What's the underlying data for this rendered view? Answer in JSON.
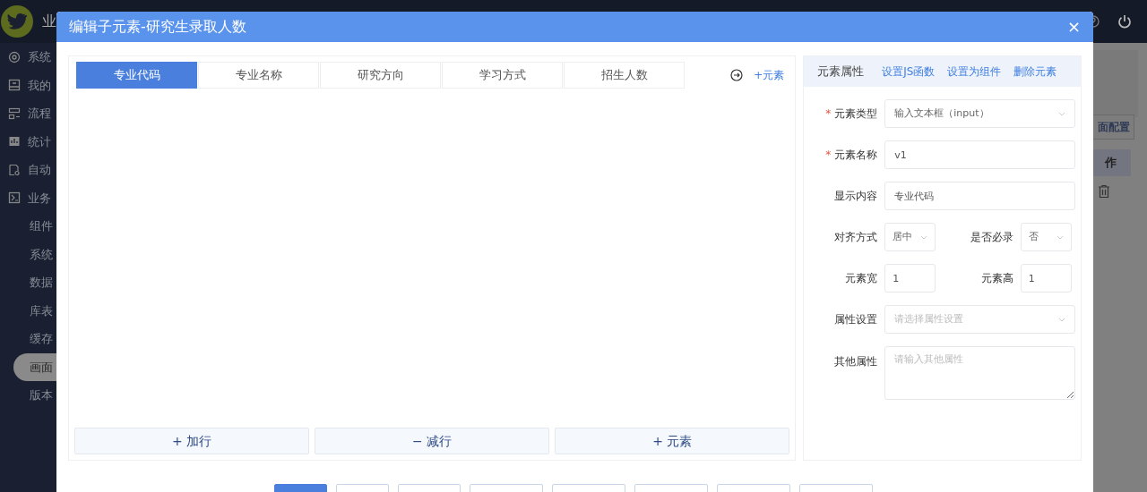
{
  "app": {
    "logo_text": "业",
    "sidebar": [
      {
        "label": "系统"
      },
      {
        "label": "我的"
      },
      {
        "label": "流程"
      },
      {
        "label": "统计"
      },
      {
        "label": "自动"
      },
      {
        "label": "业务",
        "expanded": true,
        "children": [
          {
            "label": "组件",
            "selected": false
          },
          {
            "label": "系统",
            "selected": false
          },
          {
            "label": "数据",
            "selected": false
          },
          {
            "label": "库表",
            "selected": false
          },
          {
            "label": "缓存",
            "selected": false
          },
          {
            "label": "画面",
            "selected": true
          },
          {
            "label": "版本",
            "selected": false
          }
        ]
      }
    ],
    "page_button": "面配置",
    "table_header": "作"
  },
  "dialog": {
    "title": "编辑子元素-研究生录取人数",
    "close": "×",
    "tabs": [
      {
        "label": "专业代码",
        "selected": true
      },
      {
        "label": "专业名称",
        "selected": false
      },
      {
        "label": "研究方向",
        "selected": false
      },
      {
        "label": "学习方式",
        "selected": false
      },
      {
        "label": "招生人数",
        "selected": false
      }
    ],
    "add_element_link": "+元素",
    "actions": [
      "+ 加行",
      "− 减行",
      "+ 元素"
    ],
    "properties": {
      "title": "元素属性",
      "links": [
        "设置JS函数",
        "设置为组件",
        "删除元素"
      ],
      "fields": [
        {
          "kind": "select",
          "label": "元素类型",
          "required_mark": "*",
          "value": "输入文本框（input）"
        },
        {
          "kind": "input",
          "label": "元素名称",
          "required_mark": "*",
          "value": "v1"
        },
        {
          "kind": "input",
          "label": "显示内容",
          "value": "专业代码"
        },
        {
          "kind": "pair",
          "items": [
            {
              "kind": "select",
              "label": "对齐方式",
              "value": "居中"
            },
            {
              "kind": "select",
              "label": "是否必录",
              "value": "否"
            }
          ]
        },
        {
          "kind": "pair",
          "items": [
            {
              "kind": "input",
              "label": "元素宽",
              "value": "1"
            },
            {
              "kind": "input",
              "label": "元素高",
              "value": "1"
            }
          ]
        },
        {
          "kind": "select",
          "label": "属性设置",
          "placeholder": "请选择属性设置"
        },
        {
          "kind": "textarea",
          "label": "其他属性",
          "placeholder": "请输入其他属性"
        }
      ]
    },
    "footer_buttons": [
      {
        "primary": true
      },
      {
        "primary": false
      },
      {
        "primary": false
      },
      {
        "primary": false
      },
      {
        "primary": false
      },
      {
        "primary": false
      },
      {
        "primary": false
      },
      {
        "primary": false
      }
    ]
  }
}
